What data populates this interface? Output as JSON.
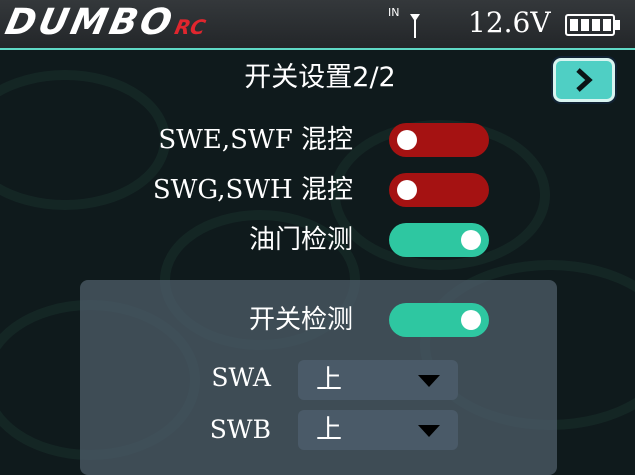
{
  "header": {
    "logo_text": "DUMBO",
    "logo_suffix": "RC",
    "signal_tag": "IN",
    "voltage": "12.6V"
  },
  "page": {
    "title": "开关设置2/2",
    "next_icon": "chevron-right-icon"
  },
  "toggles": [
    {
      "label": "SWE,SWF 混控",
      "state": "off"
    },
    {
      "label": "SWG,SWH 混控",
      "state": "off"
    },
    {
      "label": "油门检测",
      "state": "on"
    }
  ],
  "switch_check": {
    "label": "开关检测",
    "state": "on",
    "selects": [
      {
        "label": "SWA",
        "value": "上"
      },
      {
        "label": "SWB",
        "value": "上"
      }
    ]
  },
  "colors": {
    "accent": "#4fcfc4",
    "toggle_on": "#2ec7a1",
    "toggle_off": "#a51212",
    "brand_red": "#e0262e"
  }
}
